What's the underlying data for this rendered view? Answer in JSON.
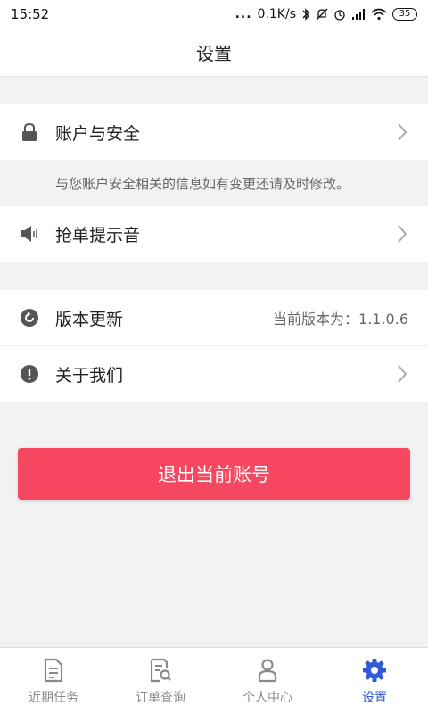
{
  "status_bar": {
    "time": "15:52",
    "dots": "...",
    "network_speed": "0.1K/s",
    "battery": "35",
    "icons": [
      "bluetooth-icon",
      "mute-icon",
      "alarm-icon",
      "signal-icon",
      "wifi-icon",
      "battery-icon"
    ]
  },
  "header": {
    "title": "设置"
  },
  "settings": {
    "account_security": {
      "label": "账户与安全",
      "icon": "lock-icon"
    },
    "hint": "与您账户安全相关的信息如有变更还请及时修改。",
    "order_sound": {
      "label": "抢单提示音",
      "icon": "speaker-icon"
    },
    "version_update": {
      "label": "版本更新",
      "value": "当前版本为：1.1.0.6",
      "icon": "refresh-icon"
    },
    "about_us": {
      "label": "关于我们",
      "icon": "info-icon"
    }
  },
  "logout_button": {
    "label": "退出当前账号",
    "color": "#f5475f"
  },
  "tabbar": {
    "active_color": "#2f5bd8",
    "tabs": [
      {
        "label": "近期任务",
        "icon": "document-icon"
      },
      {
        "label": "订单查询",
        "icon": "search-document-icon"
      },
      {
        "label": "个人中心",
        "icon": "person-icon"
      },
      {
        "label": "设置",
        "icon": "gear-icon",
        "active": true
      }
    ]
  }
}
